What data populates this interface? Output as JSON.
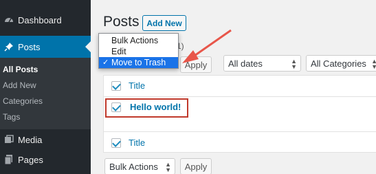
{
  "sidebar": {
    "items": [
      {
        "label": "Dashboard",
        "icon": "dashboard-icon"
      },
      {
        "label": "Posts",
        "icon": "pin-icon"
      },
      {
        "label": "Media",
        "icon": "media-icon"
      },
      {
        "label": "Pages",
        "icon": "pages-icon"
      }
    ],
    "submenu": [
      "All Posts",
      "Add New",
      "Categories",
      "Tags"
    ]
  },
  "header": {
    "title": "Posts",
    "add_new": "Add New",
    "count_peek": "1)"
  },
  "dropdown": {
    "options": [
      "Bulk Actions",
      "Edit",
      "Move to Trash"
    ],
    "selected": "Move to Trash",
    "check": "✓"
  },
  "filters": {
    "apply": "Apply",
    "dates": "All dates",
    "categories": "All Categories"
  },
  "table": {
    "column_title": "Title",
    "rows": [
      {
        "title": "Hello world!"
      }
    ],
    "footer_title": "Title"
  },
  "bottom": {
    "bulk_actions": "Bulk Actions",
    "apply": "Apply"
  },
  "colors": {
    "accent": "#0073aa",
    "sidebar": "#23282d",
    "highlight": "#c0392b",
    "arrow": "#e8564a"
  }
}
